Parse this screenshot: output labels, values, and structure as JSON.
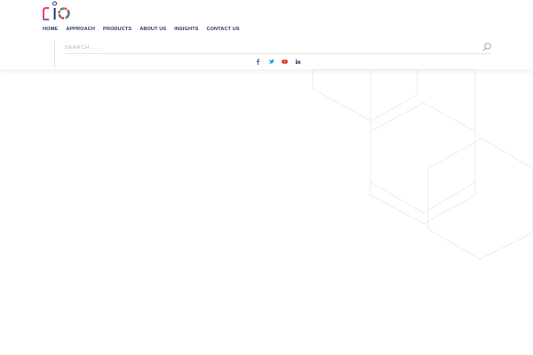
{
  "nav": {
    "items": [
      {
        "label": "HOME"
      },
      {
        "label": "APPROACH"
      },
      {
        "label": "PRODUCTS"
      },
      {
        "label": "ABOUT US"
      },
      {
        "label": "INSIGHTS"
      },
      {
        "label": "CONTACT US"
      }
    ]
  },
  "search": {
    "placeholder": "SEARCH ..."
  },
  "social": {
    "icons": [
      "facebook-icon",
      "twitter-icon",
      "youtube-icon",
      "linkedin-icon"
    ]
  },
  "colors": {
    "nav_text": "#2d3566",
    "facebook": "#3b5998",
    "twitter": "#1da1f2",
    "youtube": "#e62117",
    "linkedin": "#2d3566"
  }
}
